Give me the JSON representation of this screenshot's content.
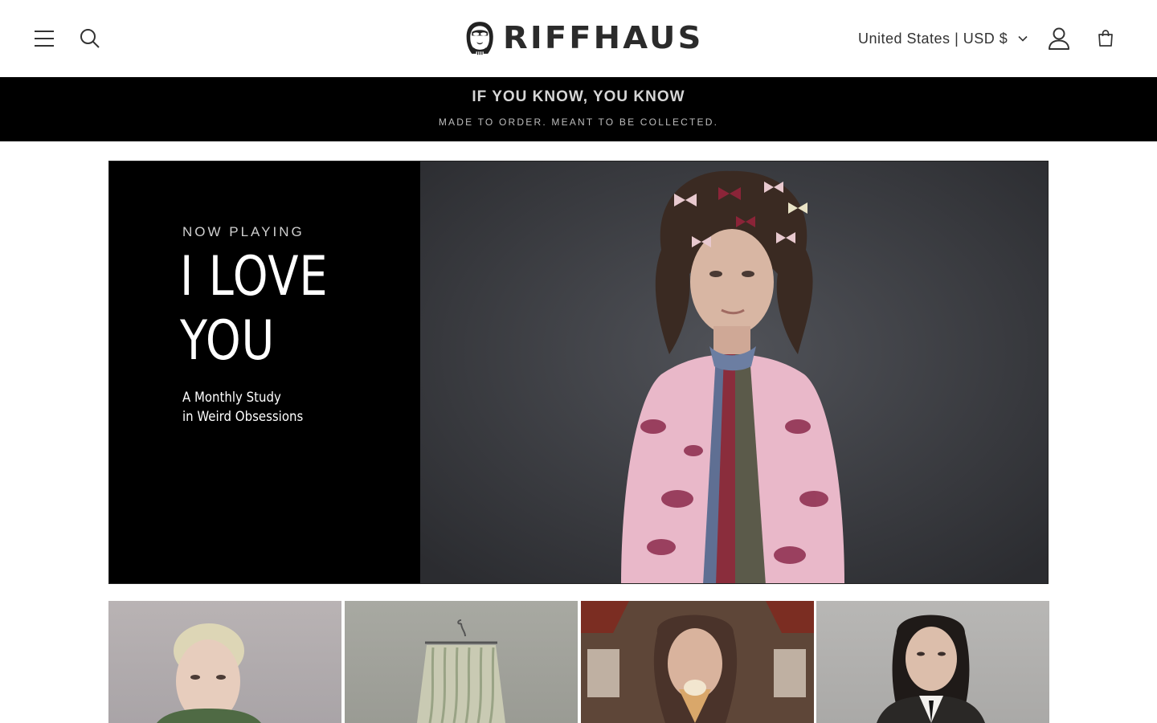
{
  "header": {
    "brand_name": "RIFFHAUS",
    "country_selector": "United States | USD $",
    "icons": {
      "menu": "hamburger-menu-icon",
      "search": "search-icon",
      "account": "account-icon",
      "cart": "cart-icon"
    }
  },
  "announcement": {
    "title": "IF YOU KNOW, YOU KNOW",
    "subtitle": "MADE TO ORDER. MEANT TO BE COLLECTED."
  },
  "hero": {
    "eyebrow": "NOW PLAYING",
    "headline_line1": "I LOVE",
    "headline_line2": "YOU",
    "subline_line1": "A Monthly Study",
    "subline_line2": "in Weird Obsessions"
  },
  "colors": {
    "header_bg": "#ffffff",
    "announcement_bg": "#000000",
    "hero_panel_bg": "#000000",
    "text_dark": "#121212"
  }
}
